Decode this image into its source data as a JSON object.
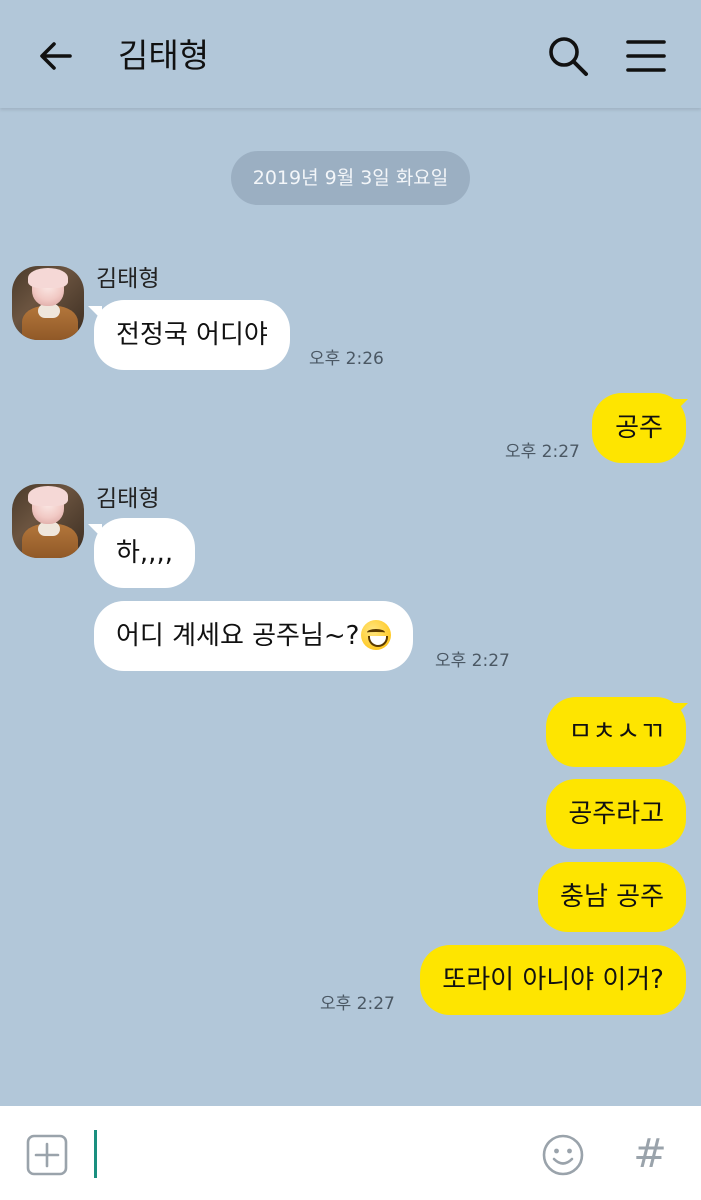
{
  "header": {
    "title": "김태형",
    "back_icon": "arrow-left-icon",
    "search_icon": "search-icon",
    "menu_icon": "hamburger-menu-icon"
  },
  "date_divider": "2019년 9월 3일 화요일",
  "colors": {
    "background": "#b2c7d9",
    "incoming_bubble": "#ffffff",
    "outgoing_bubble": "#fee500",
    "caret": "#1a8f7f"
  },
  "messages": {
    "group1": {
      "sender": "김태형",
      "text": "전정국 어디야",
      "time": "오후 2:26"
    },
    "out1": {
      "text": "공주",
      "time": "오후 2:27"
    },
    "group2": {
      "sender": "김태형",
      "text1": "하,,,,",
      "text2": "어디 계세요 공주님~?",
      "emoji": "grinning-face",
      "time": "오후 2:27"
    },
    "out2": {
      "text1": "ㅁㅊㅅㄲ",
      "text2": "공주라고",
      "text3": "충남 공주",
      "text4": "또라이 아니야 이거?",
      "time": "오후 2:27"
    }
  },
  "inputbar": {
    "value": "",
    "plus_icon": "plus-box-icon",
    "emoji_icon": "smiley-icon",
    "hash_label": "#"
  }
}
